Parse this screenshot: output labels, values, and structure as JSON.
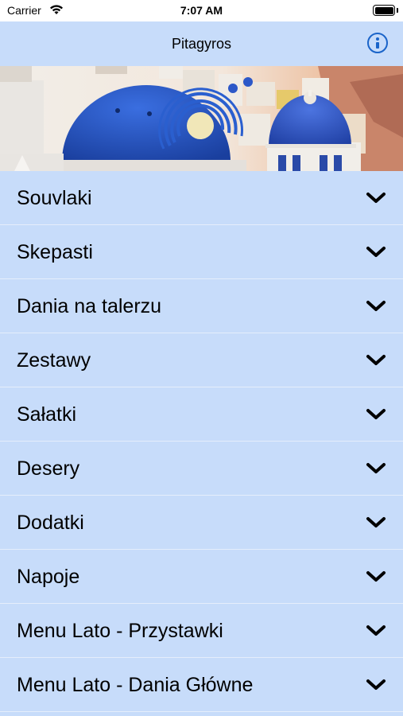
{
  "status_bar": {
    "carrier": "Carrier",
    "time": "7:07 AM"
  },
  "nav": {
    "title": "Pitagyros"
  },
  "menu": [
    {
      "label": "Souvlaki"
    },
    {
      "label": "Skepasti"
    },
    {
      "label": "Dania na talerzu"
    },
    {
      "label": "Zestawy"
    },
    {
      "label": "Sałatki"
    },
    {
      "label": "Desery"
    },
    {
      "label": "Dodatki"
    },
    {
      "label": "Napoje"
    },
    {
      "label": "Menu Lato - Przystawki"
    },
    {
      "label": "Menu Lato - Dania Główne"
    }
  ],
  "colors": {
    "background": "#c7dcfa",
    "accent": "#1a64c9"
  },
  "icons": {
    "info": "info-circle-icon",
    "chevron": "chevron-down-icon"
  }
}
